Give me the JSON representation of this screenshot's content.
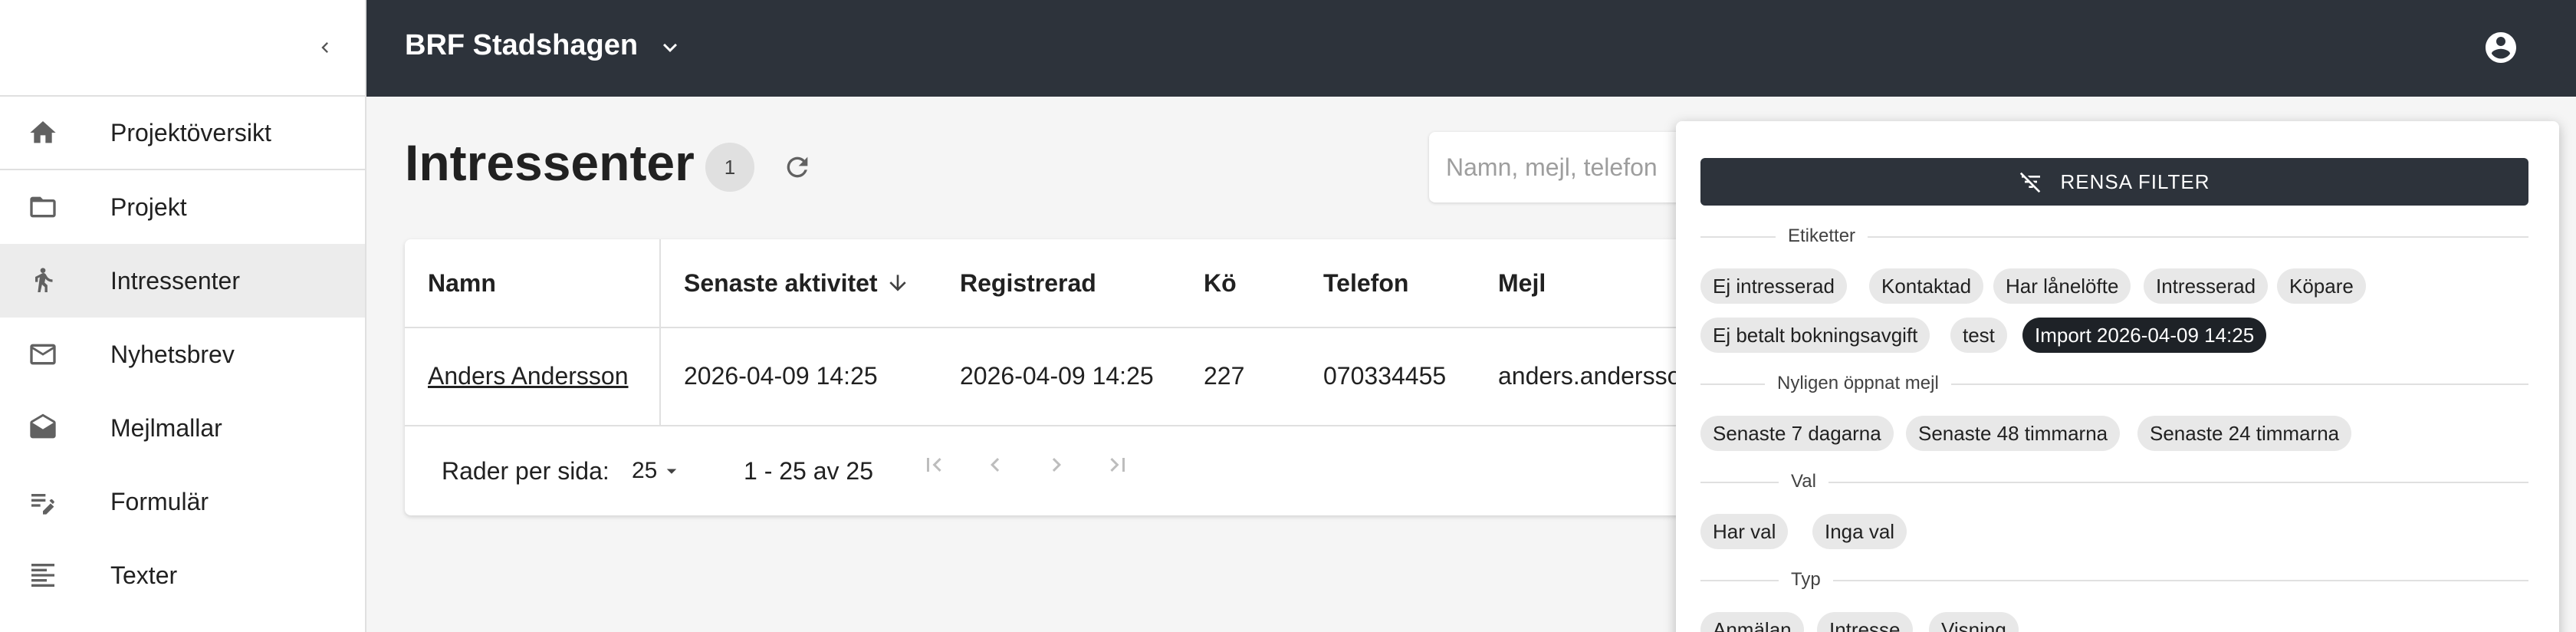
{
  "sidebar": {
    "items": [
      {
        "label": "Projektöversikt",
        "icon": "home-icon"
      },
      {
        "label": "Projekt",
        "icon": "folder-icon"
      },
      {
        "label": "Intressenter",
        "icon": "person-walking-icon"
      },
      {
        "label": "Nyhetsbrev",
        "icon": "mail-icon"
      },
      {
        "label": "Mejlmallar",
        "icon": "mail-open-icon"
      },
      {
        "label": "Formulär",
        "icon": "edit-note-icon"
      },
      {
        "label": "Texter",
        "icon": "text-lines-icon"
      }
    ]
  },
  "topbar": {
    "org": "BRF Stadshagen"
  },
  "main": {
    "title": "Intressenter",
    "count": "1",
    "search_placeholder": "Namn, mejl, telefon"
  },
  "table": {
    "headers": {
      "name": "Namn",
      "activity": "Senaste aktivitet",
      "registered": "Registrerad",
      "queue": "Kö",
      "phone": "Telefon",
      "email": "Mejl"
    },
    "rows": [
      {
        "name": "Anders Andersson",
        "activity": "2026-04-09 14:25",
        "registered": "2026-04-09 14:25",
        "queue": "227",
        "phone": "070334455",
        "email": "anders.andersso"
      }
    ],
    "pagination": {
      "rows_per_page_label": "Rader per sida:",
      "rows_per_page": "25",
      "range": "1 - 25 av 25"
    }
  },
  "filter": {
    "clear_label": "RENSA FILTER",
    "sections": {
      "tags": {
        "label": "Etiketter",
        "chips": [
          "Ej intresserad",
          "Kontaktad",
          "Har lånelöfte",
          "Intresserad",
          "Köpare",
          "Ej betalt bokningsavgift",
          "test",
          "Import 2026-04-09 14:25"
        ],
        "selected": "Import 2026-04-09 14:25"
      },
      "recent_email": {
        "label": "Nyligen öppnat mejl",
        "chips": [
          "Senaste 7 dagarna",
          "Senaste 48 timmarna",
          "Senaste 24 timmarna"
        ]
      },
      "choice": {
        "label": "Val",
        "chips": [
          "Har val",
          "Inga val"
        ]
      },
      "type": {
        "label": "Typ",
        "chips": [
          "Anmälan",
          "Intresse",
          "Visning"
        ]
      }
    }
  },
  "colors": {
    "topbar": "#2d333b",
    "selected_chip": "#1e2227",
    "chip": "#e8e8e8",
    "active_nav": "#ececec"
  }
}
